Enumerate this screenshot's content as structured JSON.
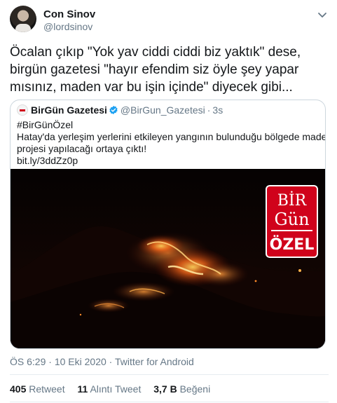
{
  "author": {
    "name": "Con Sinov",
    "handle": "@lordsinov"
  },
  "tweet": {
    "lines": [
      "Öcalan çıkıp \"Yok yav ciddi ciddi biz yaktık\" dese,",
      "birgün gazetesi \"hayır efendim siz öyle şey yapar",
      "mısınız, maden var bu işin içinde\" diyecek gibi..."
    ]
  },
  "quoted": {
    "name": "BirGün Gazetesi",
    "handle": "@BirGun_Gazetesi",
    "separator": "·",
    "time": "3s",
    "lines": [
      "#BirGünÖzel",
      "Hatay'da yerleşim yerlerini etkileyen yangının bulunduğu bölgede maden",
      "projesi yapılacağı ortaya çıktı!",
      "bit.ly/3ddZz0p"
    ],
    "badge": {
      "top": "BİR",
      "middle": "Gün",
      "bottom": "ÖZEL",
      "color": "#d0021b"
    }
  },
  "meta": {
    "time": "ÖS 6:29",
    "separator": "·",
    "date": "10 Eki 2020",
    "source": "Twitter for Android"
  },
  "stats": {
    "retweets": "405",
    "retweets_label": "Retweet",
    "quotes": "11",
    "quotes_label": "Alıntı Tweet",
    "likes": "3,7 B",
    "likes_label": "Beğeni"
  },
  "colors": {
    "text": "#14171a",
    "secondary": "#657786",
    "border": "#ccd6dd",
    "verified": "#1da1f2"
  },
  "icons": {
    "caret": "chevron-down-icon",
    "verified": "verified-badge-icon"
  }
}
